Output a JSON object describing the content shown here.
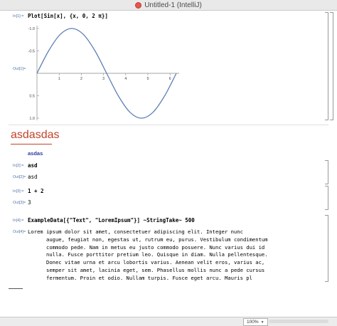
{
  "window": {
    "title": "Untitled-1 (IntelliJ)"
  },
  "cells": {
    "in1_label": "In[1]:=",
    "in1_code": "Plot[Sin[x], {x, 0, 2 π}]",
    "out1_label": "Out[1]=",
    "section_title": "asdasdas",
    "text_cell": "asdas",
    "in2_label": "In[2]:=",
    "in2_code": "asd",
    "out2_label": "Out[2]=",
    "out2_value": "asd",
    "in3_label": "In[3]:=",
    "in3_code": "1 + 2",
    "out3_label": "Out[3]=",
    "out3_value": "3",
    "in4_label": "In[4]:=",
    "in4_code": "ExampleData[{\"Text\", \"LoremIpsum\"}] ~StringTake~ 500",
    "out4_label": "Out[4]=",
    "out4_lines": [
      "Lorem ipsum dolor sit amet, consectetuer adipiscing elit. Integer nunc",
      "augue, feugiat non, egestas ut, rutrum eu, purus. Vestibulum condimentum",
      "commodo pede. Nam in metus eu justo commodo posuere. Nunc varius dui id",
      "nulla. Fusce porttitor pretium leo. Quisque in diam. Nulla pellentesque.",
      "Donec vitae urna et arcu lobortis varius. Aenean velit eros, varius ac,",
      "semper sit amet, lacinia eget, sem. Phasellus mollis nunc a pede cursus",
      "fermentum. Proin et odio. Nullam turpis. Fusce eget arcu. Mauris pl"
    ]
  },
  "plot": {
    "y_ticks": [
      "1.0",
      "0.5",
      "-0.5",
      "-1.0"
    ],
    "x_ticks": [
      "1",
      "2",
      "3",
      "4",
      "5",
      "6"
    ],
    "curve_color": "#5e81b5"
  },
  "chart_data": {
    "type": "line",
    "title": "",
    "xlabel": "",
    "ylabel": "",
    "xlim": [
      0,
      6.2832
    ],
    "ylim": [
      -1.0,
      1.0
    ],
    "x_ticks": [
      1,
      2,
      3,
      4,
      5,
      6
    ],
    "y_ticks": [
      -1.0,
      -0.5,
      0.5,
      1.0
    ],
    "series": [
      {
        "x": [
          0,
          0.524,
          1.047,
          1.571,
          2.094,
          2.618,
          3.142,
          3.665,
          4.189,
          4.712,
          5.236,
          5.76,
          6.283
        ],
        "values": [
          0,
          0.5,
          0.866,
          1.0,
          0.866,
          0.5,
          0,
          -0.5,
          -0.866,
          -1.0,
          -0.866,
          -0.5,
          0
        ]
      }
    ]
  },
  "statusbar": {
    "zoom": "100%"
  }
}
